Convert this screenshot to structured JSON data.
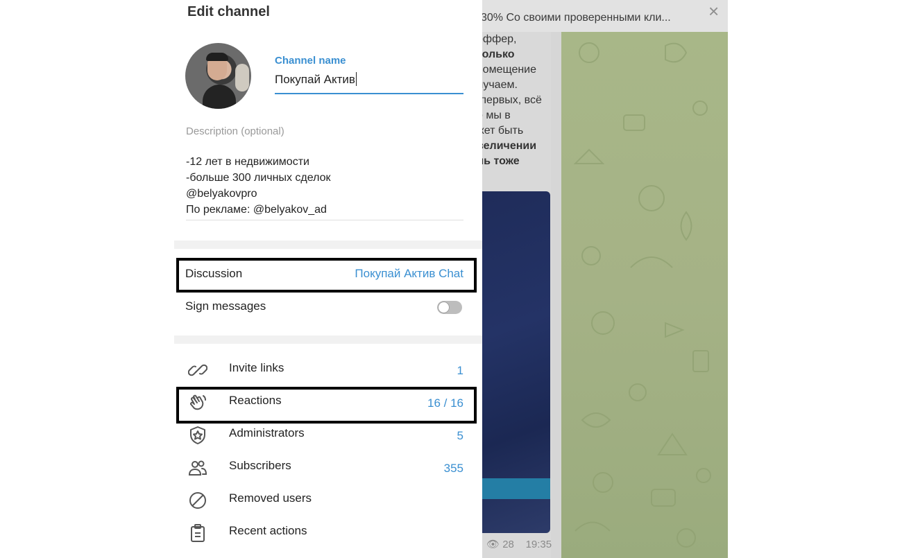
{
  "background": {
    "pinned_text": "30%  Со своими проверенными кли...",
    "close_glyph": "×",
    "message_lines": [
      "оффер,",
      "только",
      "помещение",
      "лучаем.",
      "-первых, всё",
      "о мы в",
      "жет быть",
      "величении",
      "ль тоже"
    ],
    "bold_line_indices": [
      1,
      7,
      8
    ],
    "views": "28",
    "time": "19:35"
  },
  "dialog": {
    "title": "Edit channel",
    "channel_name_label": "Channel name",
    "channel_name_value": "Покупай Актив",
    "description_label": "Description (optional)",
    "description_lines": [
      "-12 лет в недвижимости",
      "-больше 300 личных сделок",
      "@belyakovpro",
      "По рекламе: @belyakov_ad"
    ],
    "discussion": {
      "label": "Discussion",
      "value": "Покупай Актив Chat"
    },
    "sign_messages": {
      "label": "Sign messages",
      "enabled": false
    },
    "menu": [
      {
        "key": "invite-links",
        "icon": "link-icon",
        "label": "Invite links",
        "value": "1"
      },
      {
        "key": "reactions",
        "icon": "reactions-hand-icon",
        "label": "Reactions",
        "value": "16 / 16"
      },
      {
        "key": "administrators",
        "icon": "admin-shield-star-icon",
        "label": "Administrators",
        "value": "5"
      },
      {
        "key": "subscribers",
        "icon": "users-icon",
        "label": "Subscribers",
        "value": "355"
      },
      {
        "key": "removed-users",
        "icon": "blocked-icon",
        "label": "Removed users",
        "value": ""
      },
      {
        "key": "recent-actions",
        "icon": "clipboard-icon",
        "label": "Recent actions",
        "value": ""
      }
    ]
  },
  "colors": {
    "accent": "#3a8fd1",
    "highlight_border": "#000000"
  }
}
